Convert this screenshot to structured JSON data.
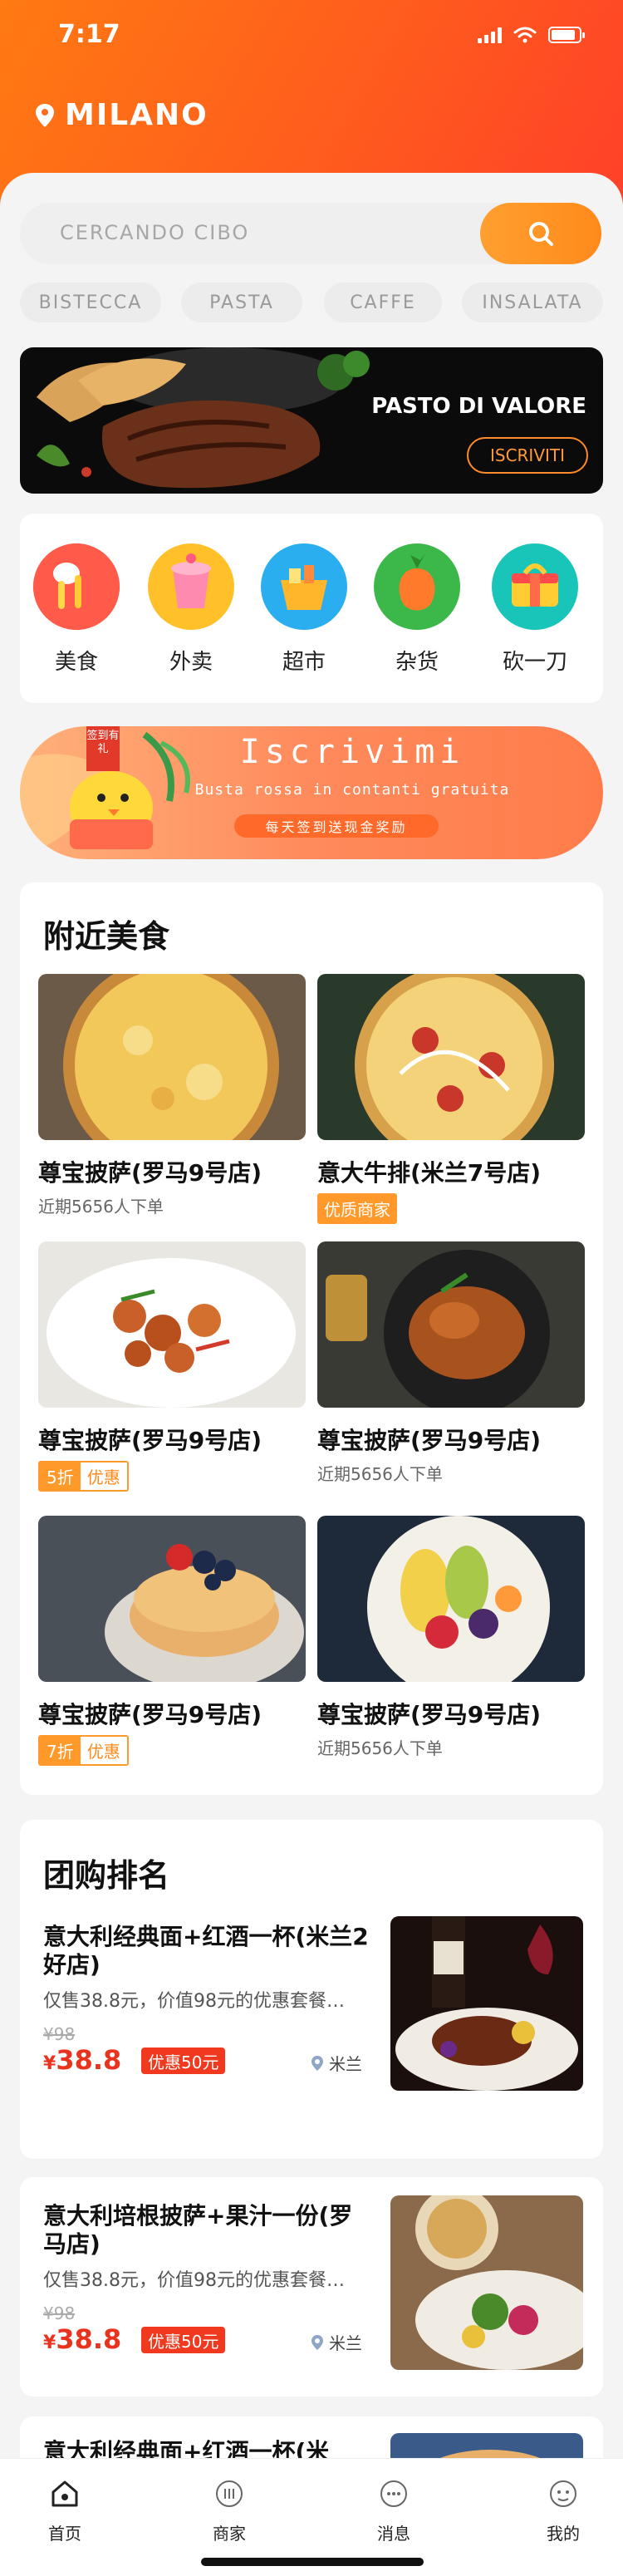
{
  "status": {
    "time": "7:17"
  },
  "location": {
    "city": "MILANO"
  },
  "search": {
    "placeholder": "CERCANDO CIBO"
  },
  "chips": [
    "BISTECCA",
    "PASTA",
    "CAFFE",
    "INSALATA"
  ],
  "banner": {
    "title": "PASTO DI VALORE",
    "button": "ISCRIVITI"
  },
  "categories": [
    {
      "label": "美食",
      "icon": "food-icon"
    },
    {
      "label": "外卖",
      "icon": "takeout-icon"
    },
    {
      "label": "超市",
      "icon": "supermarket-icon"
    },
    {
      "label": "杂货",
      "icon": "grocery-icon"
    },
    {
      "label": "砍一刀",
      "icon": "gift-box-icon"
    }
  ],
  "promo": {
    "title": "Iscrivimi",
    "subtitle": "Busta rossa in contanti gratuita",
    "pill": "每天签到送现金奖励",
    "badge": "签到有礼"
  },
  "nearby": {
    "title": "附近美食",
    "items": [
      {
        "name": "尊宝披萨(罗马9号店)",
        "meta": "近期5656人下单",
        "tag": "",
        "discount": "",
        "deal": ""
      },
      {
        "name": "意大牛排(米兰7号店)",
        "meta": "",
        "tag": "优质商家",
        "discount": "",
        "deal": ""
      },
      {
        "name": "尊宝披萨(罗马9号店)",
        "meta": "",
        "tag": "",
        "discount": "5折",
        "deal": "优惠"
      },
      {
        "name": "尊宝披萨(罗马9号店)",
        "meta": "近期5656人下单",
        "tag": "",
        "discount": "",
        "deal": ""
      },
      {
        "name": "尊宝披萨(罗马9号店)",
        "meta": "",
        "tag": "",
        "discount": "7折",
        "deal": "优惠"
      },
      {
        "name": "尊宝披萨(罗马9号店)",
        "meta": "近期5656人下单",
        "tag": "",
        "discount": "",
        "deal": ""
      }
    ]
  },
  "group": {
    "title": "团购排名",
    "items": [
      {
        "title": "意大利经典面+红酒一杯(米兰2好店)",
        "desc": "仅售38.8元，价值98元的优惠套餐…",
        "old_price": "¥98",
        "currency": "¥",
        "price": "38.8",
        "coupon": "优惠50元",
        "location": "米兰"
      },
      {
        "title": "意大利培根披萨+果汁一份(罗马店)",
        "desc": "仅售38.8元，价值98元的优惠套餐…",
        "old_price": "¥98",
        "currency": "¥",
        "price": "38.8",
        "coupon": "优惠50元",
        "location": "米兰"
      },
      {
        "title": "意大利经典面+红酒一杯(米",
        "desc": "",
        "old_price": "",
        "currency": "",
        "price": "",
        "coupon": "",
        "location": ""
      }
    ]
  },
  "tabbar": [
    {
      "label": "首页",
      "icon": "home-icon"
    },
    {
      "label": "商家",
      "icon": "store-icon"
    },
    {
      "label": "消息",
      "icon": "message-icon"
    },
    {
      "label": "我的",
      "icon": "profile-icon"
    }
  ],
  "colors": {
    "accent": "#ff8a1a",
    "header_start": "#ff7a12",
    "header_end": "#ff3d2a",
    "price": "#e8331f"
  }
}
